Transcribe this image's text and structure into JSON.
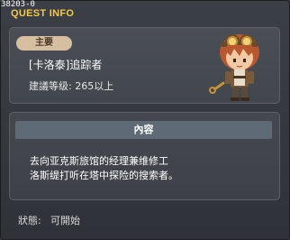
{
  "window": {
    "quest_id": "38203-0",
    "title": "QUEST INFO",
    "title_color": "#f2c94a"
  },
  "quest": {
    "badge": "主要",
    "name": "[卡洛泰]追踪者",
    "level": "建議等级: 265以上",
    "npc_icon": "npc-character-portrait"
  },
  "content": {
    "header": "內容",
    "lines": [
      "去向亚克斯旅馆的经理兼维修工",
      "洛斯缇打听在塔中探险的搜索者。"
    ]
  },
  "status": {
    "label": "狀態:",
    "value": "可開始"
  }
}
